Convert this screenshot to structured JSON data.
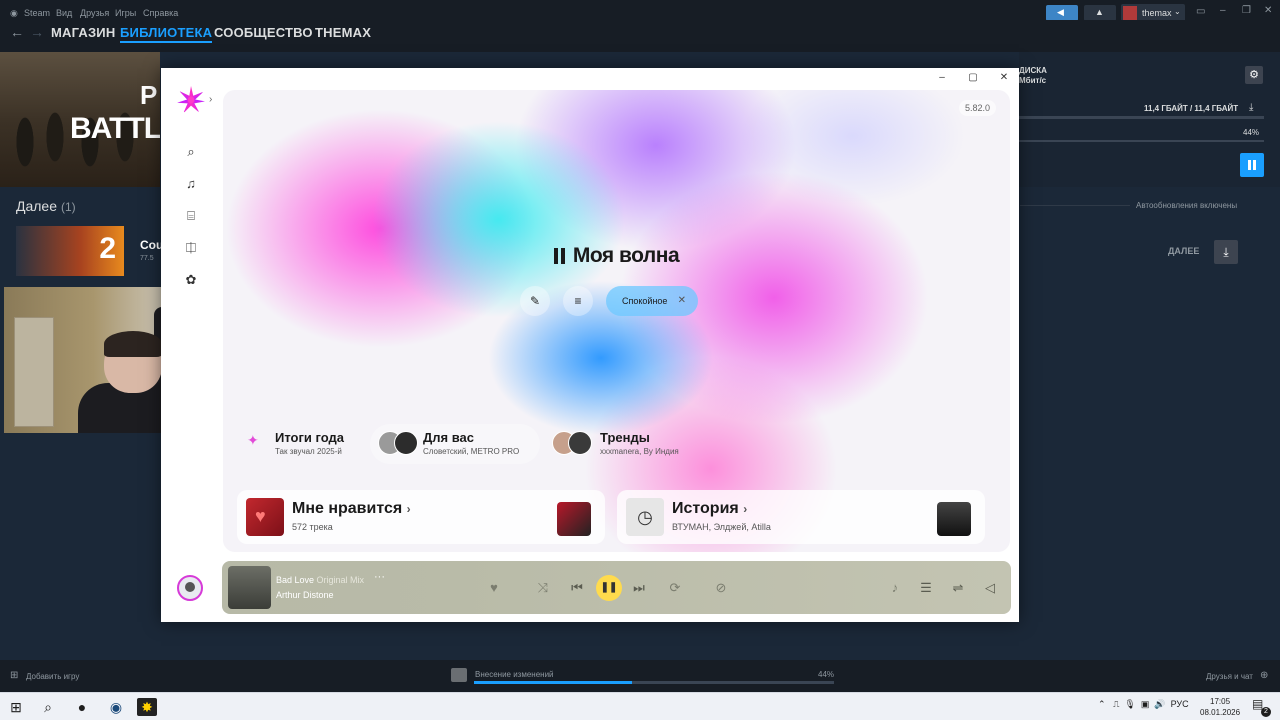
{
  "steam": {
    "menu": [
      "Steam",
      "Вид",
      "Друзья",
      "Игры",
      "Справка"
    ],
    "nav": [
      "МАГАЗИН",
      "БИБЛИОТЕКА",
      "СООБЩЕСТВО",
      "THEMAX"
    ],
    "active_nav": "БИБЛИОТЕКА",
    "username": "themax",
    "hero_title": "BATTLEF",
    "hero_partial": "P",
    "download": {
      "disk_label": "ДИСКА",
      "speed": "Мбит/с",
      "size": "11,4 ГБАЙТ / 11,4 ГБАЙТ",
      "percent": "44%"
    },
    "queue": {
      "title": "Далее",
      "count": "(1)",
      "auto_updates": "Автообновления включены",
      "game_title": "Cou",
      "game_sub": "77.5",
      "next_btn": "ДАЛЕЕ"
    },
    "footer": {
      "add_game": "Добавить игру",
      "status": "Внесение изменений",
      "percent": "44%",
      "progress": 0.44,
      "friends": "Друзья и чат"
    }
  },
  "taskbar": {
    "lang": "РУС",
    "time": "17:05",
    "date": "08.01.2026",
    "notif_count": "2"
  },
  "music": {
    "version": "5.82.0",
    "wave_title": "Моя волна",
    "mood": "Спокойное",
    "shelves": [
      {
        "title": "Итоги года",
        "sub": "Так звучал 2025-й"
      },
      {
        "title": "Для вас",
        "sub": "Словетский, METRO PRO"
      },
      {
        "title": "Тренды",
        "sub": "xxxmanera, By Индия"
      }
    ],
    "likes": {
      "title": "Мне нравится",
      "sub": "572 трека"
    },
    "history": {
      "title": "История",
      "sub": "ВТУМАН, Элджей, Atilla"
    },
    "player": {
      "track": "Bad Love",
      "mix": "Original Mix",
      "artist": "Arthur Distone"
    }
  },
  "colors": {
    "steam_accent": "#1a9fff",
    "steam_bg": "#1b2838",
    "ym_play": "#ffdb4d"
  }
}
